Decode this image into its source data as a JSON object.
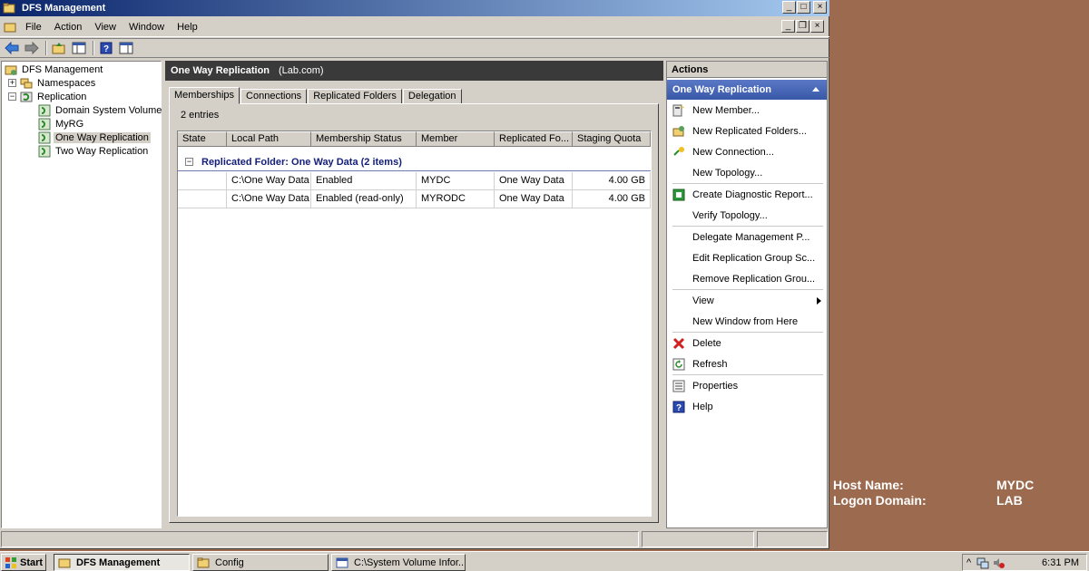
{
  "window": {
    "title": "DFS Management",
    "caption_buttons": {
      "minimize": "_",
      "maximize": "□",
      "close": "×"
    },
    "mdi_buttons": {
      "minimize": "_",
      "restore": "❐",
      "close": "×"
    }
  },
  "menu": [
    "File",
    "Action",
    "View",
    "Window",
    "Help"
  ],
  "tree": {
    "root": "DFS Management",
    "namespaces": "Namespaces",
    "replication": "Replication",
    "groups": [
      "Domain System Volume",
      "MyRG",
      "One Way Replication",
      "Two Way Replication"
    ],
    "selected": "One Way Replication"
  },
  "center": {
    "header_title": "One Way Replication",
    "header_domain": "(Lab.com)",
    "tabs": [
      "Memberships",
      "Connections",
      "Replicated Folders",
      "Delegation"
    ],
    "entries": "2 entries",
    "columns": [
      "State",
      "Local Path",
      "Membership Status",
      "Member",
      "Replicated Fo...",
      "Staging Quota"
    ],
    "group_label": "Replicated Folder: One Way Data (2 items)",
    "rows": [
      {
        "state": "",
        "local_path": "C:\\One Way Data",
        "status": "Enabled",
        "member": "MYDC",
        "folder": "One Way Data",
        "quota": "4.00 GB"
      },
      {
        "state": "",
        "local_path": "C:\\One Way Data",
        "status": "Enabled (read-only)",
        "member": "MYRODC",
        "folder": "One Way Data",
        "quota": "4.00 GB"
      }
    ]
  },
  "actions": {
    "header": "Actions",
    "section": "One Way Replication",
    "items": [
      "New Member...",
      "New Replicated Folders...",
      "New Connection...",
      "New Topology...",
      "Create Diagnostic Report...",
      "Verify Topology...",
      "Delegate Management P...",
      "Edit Replication Group Sc...",
      "Remove Replication Grou...",
      "View",
      "New Window from Here",
      "Delete",
      "Refresh",
      "Properties",
      "Help"
    ]
  },
  "bginfo": {
    "host_label": "Host Name:",
    "host_value": "MYDC",
    "domain_label": "Logon Domain:",
    "domain_value": "LAB"
  },
  "taskbar": {
    "start": "Start",
    "tasks": [
      "DFS Management",
      "Config",
      "C:\\System Volume Infor..."
    ],
    "clock": "6:31 PM"
  },
  "colors": {
    "desktop": "#9c6a4e",
    "titlebar_start": "#0a246a",
    "titlebar_end": "#a6caf0",
    "actions_section": "#3858a8",
    "group_text": "#15207a"
  }
}
